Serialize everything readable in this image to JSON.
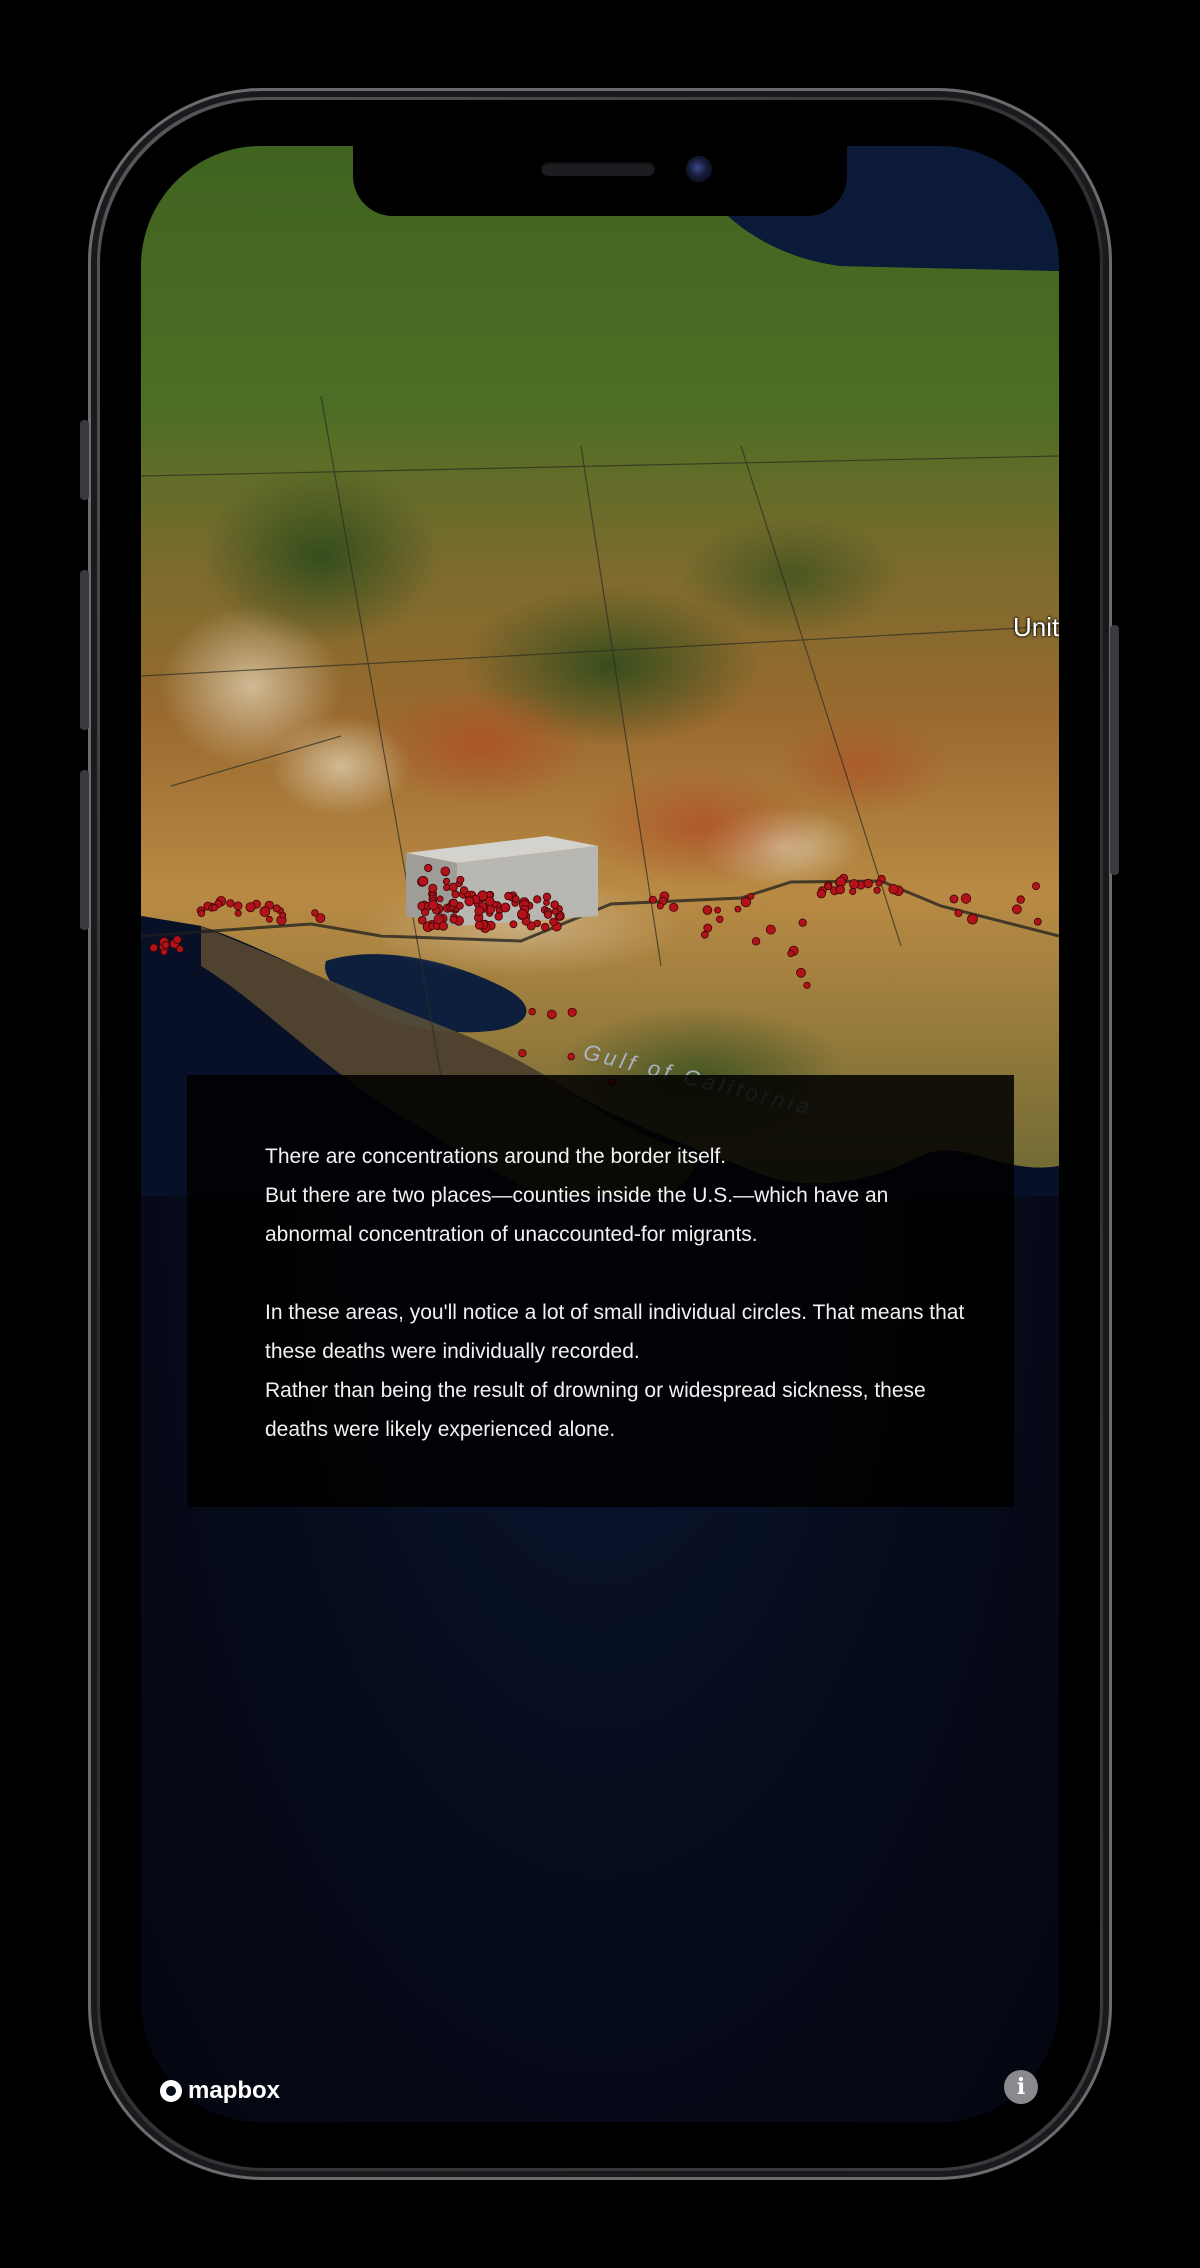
{
  "map": {
    "country_label": "Unit",
    "water_label": "Gulf of California",
    "attribution_logo": "mapbox",
    "info_button_glyph": "i",
    "marker_color": "#b3121a"
  },
  "story": {
    "paragraphs": [
      "There are concentrations around the border itself.",
      "But there are two places—counties inside the U.S.—which have an abnormal concentration of unaccounted-for migrants.",
      "In these areas, you'll notice a lot of small individual circles. That means that these deaths were individually recorded.",
      "Rather than being the result of drowning or widespread sickness, these deaths were likely experienced alone."
    ]
  }
}
